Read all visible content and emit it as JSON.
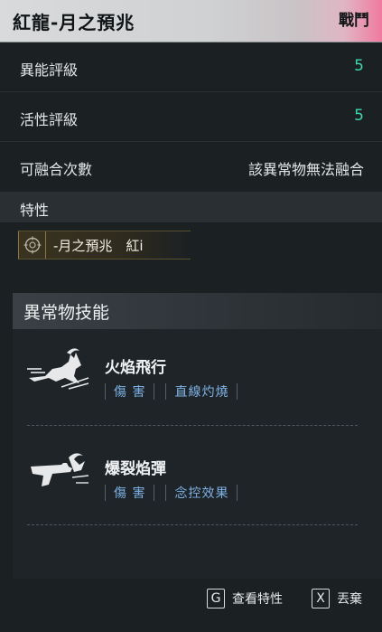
{
  "header": {
    "title": "紅龍-月之預兆",
    "tag": "戰鬥"
  },
  "stats": [
    {
      "label": "異能評級",
      "value": "5"
    },
    {
      "label": "活性評級",
      "value": "5"
    },
    {
      "label": "可融合次數",
      "value": "該異常物無法融合"
    }
  ],
  "traits": {
    "heading": "特性",
    "chip_text": "-月之預兆　紅i",
    "chip_icon": "crosshair-icon"
  },
  "skills": {
    "heading": "異常物技能",
    "items": [
      {
        "name": "火焰飛行",
        "icon": "goat-dash-icon",
        "tags": [
          "傷 害",
          "直線灼燒"
        ]
      },
      {
        "name": "爆裂焰彈",
        "icon": "goat-gun-icon",
        "tags": [
          "傷 害",
          "念控效果"
        ]
      }
    ]
  },
  "footer": {
    "hints": [
      {
        "key": "G",
        "label": "查看特性"
      },
      {
        "key": "X",
        "label": "丟棄"
      }
    ]
  },
  "colors": {
    "accent_value": "#3fd6b0",
    "tag_text": "#7fb2e6",
    "header_pink": "#f07aa0"
  }
}
